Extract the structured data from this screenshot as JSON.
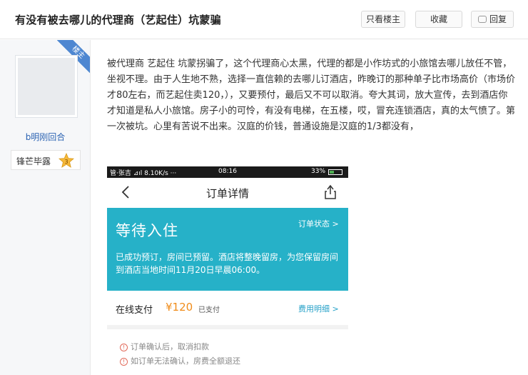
{
  "header": {
    "title": "有没有被去哪儿的代理商（艺起住）坑蒙骗",
    "buttons": {
      "only_author": "只看楼主",
      "favorite": "收藏",
      "reply": "回复"
    }
  },
  "author": {
    "badge": "楼主",
    "username": "b明刚回合",
    "level_name": "锋芒毕露",
    "level_number": "3",
    "accent_color": "#4e87d1"
  },
  "post": {
    "text": "被代理商 艺起住 坑蒙拐骗了，这个代理商心太黑，代理的都是小作坊式的小旅馆去哪儿放任不管，坐视不理。由于人生地不熟，选择一直信赖的去哪儿订酒店，昨晚订的那种单子比市场高价（市场价才80左右，而艺起住卖120，），又要预付，最后又不可以取消。夸大其词，放大宣传，去到酒店你才知道是私人小旅馆。房子小的可怜，有没有电梯，在五楼，哎，冒充连锁酒店，真的太气愤了。第一次被坑。心里有苦说不出来。汉庭的价钱，普通设施是汉庭的1/3都没有，"
  },
  "screenshot": {
    "status_bar": {
      "left": "管·张吉 ⊿ıl 8.10K/s ···",
      "time": "08:16",
      "battery": "33%"
    },
    "nav_title": "订单详情",
    "order_card": {
      "status": "等待入住",
      "status_link": "订单状态 >",
      "description": "已成功预订，房间已预留。酒店将整晚留房，为您保留房间到酒店当地时间11月20日早晨06:00。",
      "color": "#26b1c8"
    },
    "payment": {
      "label": "在线支付",
      "amount": "¥120",
      "status": "已支付",
      "detail_link": "费用明细 >"
    },
    "notes": [
      "订单确认后，取消扣款",
      "如订单无法确认，房费全额退还"
    ]
  }
}
